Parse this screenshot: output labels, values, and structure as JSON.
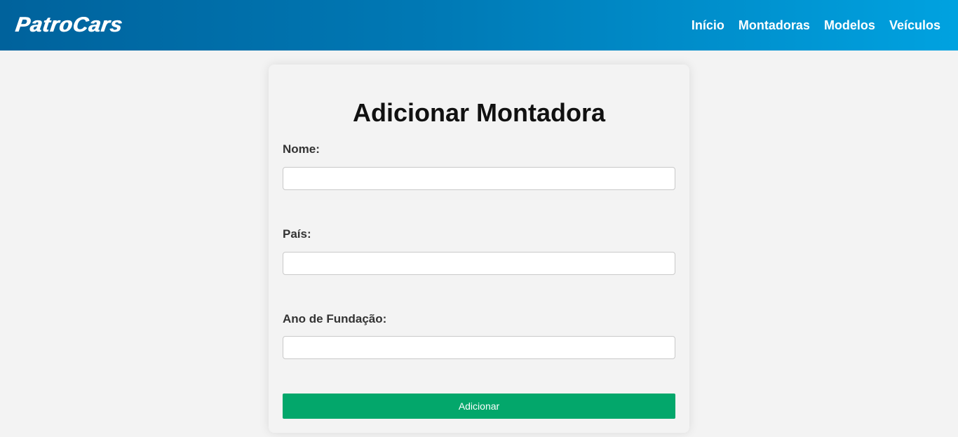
{
  "brand": {
    "name": "PatroCars",
    "header_gradient": [
      "#00629c",
      "#00a2e0"
    ]
  },
  "nav": {
    "items": [
      {
        "label": "Início"
      },
      {
        "label": "Montadoras"
      },
      {
        "label": "Modelos"
      },
      {
        "label": "Veículos"
      }
    ]
  },
  "form": {
    "title": "Adicionar Montadora",
    "fields": [
      {
        "label": "Nome:",
        "value": "",
        "placeholder": ""
      },
      {
        "label": "País:",
        "value": "",
        "placeholder": ""
      },
      {
        "label": "Ano de Fundação:",
        "value": "",
        "placeholder": ""
      }
    ],
    "submit_label": "Adicionar",
    "submit_color": "#03a76b"
  }
}
